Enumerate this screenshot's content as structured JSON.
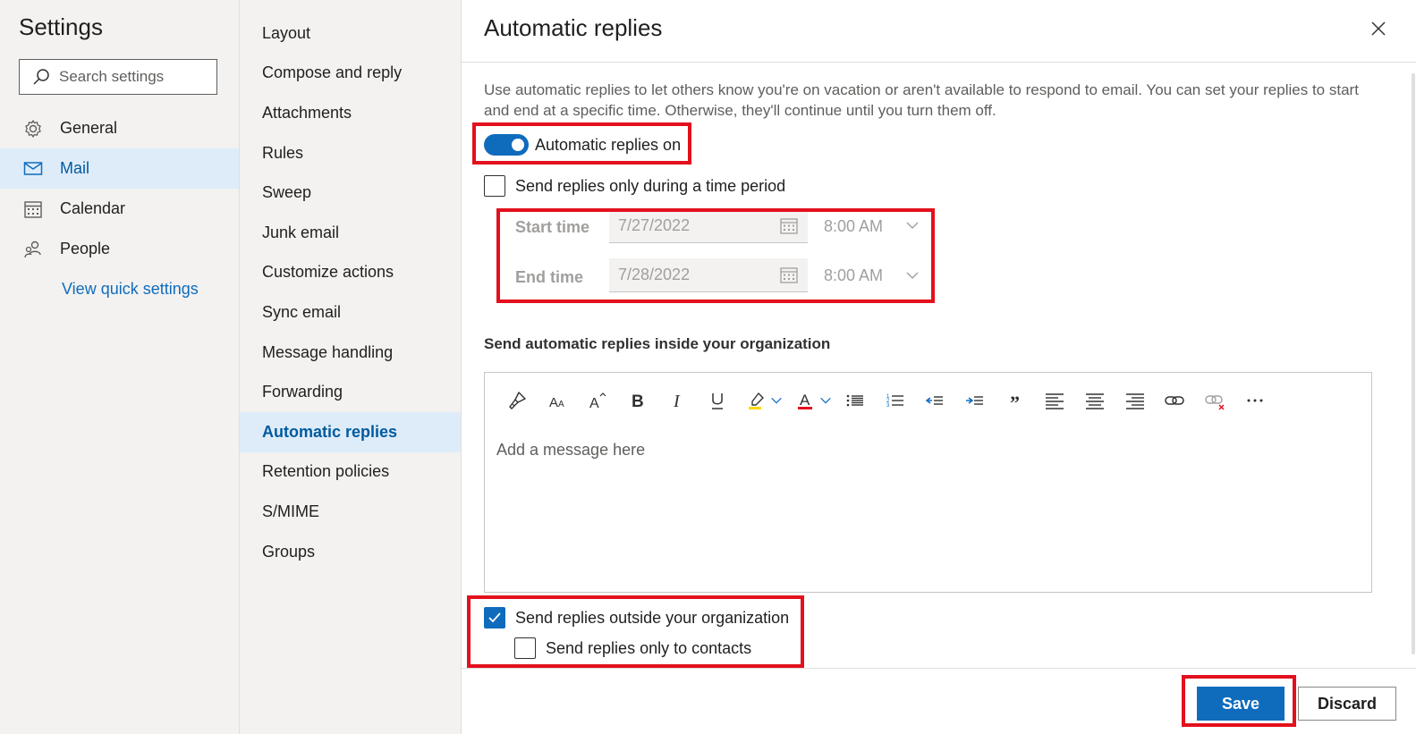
{
  "sidebar": {
    "title": "Settings",
    "search_placeholder": "Search settings",
    "items": [
      {
        "label": "General",
        "icon": "gear-icon"
      },
      {
        "label": "Mail",
        "icon": "mail-icon"
      },
      {
        "label": "Calendar",
        "icon": "calendar-icon"
      },
      {
        "label": "People",
        "icon": "people-icon"
      }
    ],
    "active_item": "Mail",
    "quick_link": "View quick settings"
  },
  "mail_settings": {
    "items": [
      "Layout",
      "Compose and reply",
      "Attachments",
      "Rules",
      "Sweep",
      "Junk email",
      "Customize actions",
      "Sync email",
      "Message handling",
      "Forwarding",
      "Automatic replies",
      "Retention policies",
      "S/MIME",
      "Groups"
    ],
    "active_item": "Automatic replies"
  },
  "panel": {
    "title": "Automatic replies",
    "description": "Use automatic replies to let others know you're on vacation or aren't available to respond to email. You can set your replies to start and end at a specific time. Otherwise, they'll continue until you turn them off.",
    "toggle_label": "Automatic replies on",
    "toggle_on": true,
    "time_period_label": "Send replies only during a time period",
    "time_period_checked": false,
    "start_label": "Start time",
    "start_date": "7/27/2022",
    "start_time": "8:00 AM",
    "end_label": "End time",
    "end_date": "7/28/2022",
    "end_time": "8:00 AM",
    "inside_label": "Send automatic replies inside your organization",
    "message_placeholder": "Add a message here",
    "outside_label": "Send replies outside your organization",
    "outside_checked": true,
    "contacts_label": "Send replies only to contacts",
    "contacts_checked": false,
    "save_label": "Save",
    "discard_label": "Discard"
  },
  "colors": {
    "accent": "#0f6cbd",
    "highlight_box": "#e3101d",
    "nav_active_bg": "#deecf9"
  }
}
